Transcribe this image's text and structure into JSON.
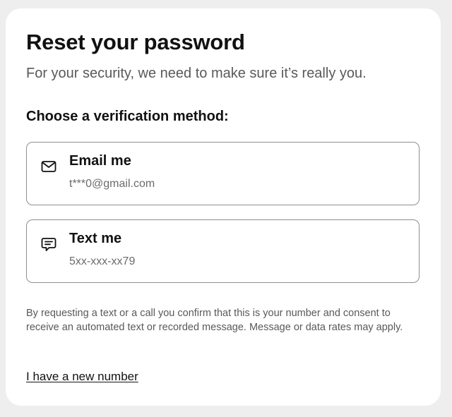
{
  "header": {
    "title": "Reset your password",
    "subtitle": "For your security, we need to make sure it’s really you."
  },
  "verification": {
    "heading": "Choose a verification method:",
    "options": [
      {
        "label": "Email me",
        "value": "t***0@gmail.com",
        "icon": "envelope-icon"
      },
      {
        "label": "Text me",
        "value": "5xx-xxx-xx79",
        "icon": "chat-icon"
      }
    ]
  },
  "disclaimer": "By requesting a text or a call you confirm that this is your number and consent to receive an automated text or recorded message. Message or data rates may apply.",
  "links": {
    "new_number": "I have a new number"
  },
  "colors": {
    "text": "#111111",
    "muted": "#595959",
    "border": "#8f8f8f",
    "background": "#eeeeee",
    "card": "#ffffff"
  }
}
